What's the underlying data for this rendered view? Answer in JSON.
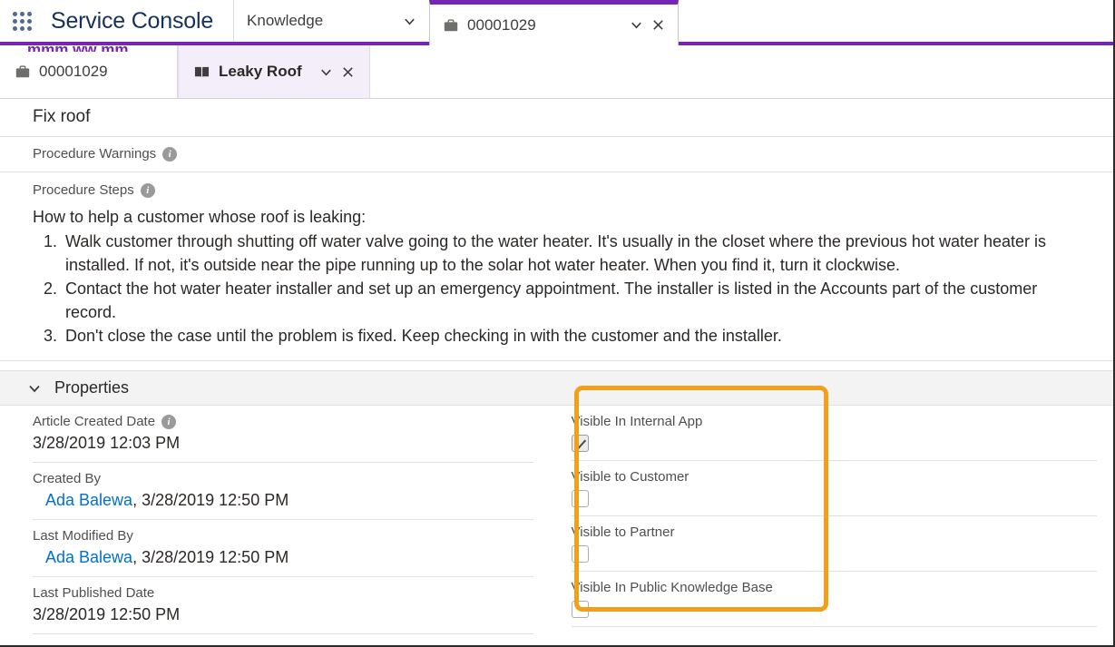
{
  "header": {
    "app_launcher_icon": "app-launcher-grid-icon",
    "app_name": "Service Console",
    "tabs": [
      {
        "label": "Knowledge",
        "icon": null,
        "active": false,
        "has_chevron": true,
        "has_close": false
      },
      {
        "label": "00001029",
        "icon": "case-briefcase-icon",
        "active": true,
        "has_chevron": true,
        "has_close": true
      }
    ],
    "accent_color": "#7526b5"
  },
  "subtabs": {
    "items": [
      {
        "label": "00001029",
        "icon": "case-briefcase-icon",
        "active": false,
        "has_chevron": false,
        "has_close": false
      },
      {
        "label": "Leaky Roof",
        "icon": "knowledge-book-icon",
        "active": true,
        "has_chevron": true,
        "has_close": true
      }
    ],
    "active_background": "#f4eefa"
  },
  "article": {
    "title": "Fix roof",
    "fields": [
      {
        "label": "Procedure Warnings",
        "has_info": true,
        "value": ""
      },
      {
        "label": "Procedure Steps",
        "has_info": true,
        "value": ""
      }
    ],
    "steps_intro": "How to help a customer whose roof is leaking:",
    "steps": [
      "Walk customer through shutting off water valve going to the water heater. It's usually in the closet where the previous hot water heater is installed. If not, it's outside near the pipe running up to the solar hot water heater. When you find it, turn it clockwise.",
      "Contact the hot water heater installer and set up an emergency appointment. The installer is listed in the Accounts part of the customer record.",
      "Don't close the case until the problem is fixed. Keep checking in with the customer and the installer."
    ]
  },
  "properties": {
    "section_title": "Properties",
    "collapse_icon": "chevron-down-icon",
    "left_fields": [
      {
        "label": "Article Created Date",
        "has_info": true,
        "value": "3/28/2019 12:03 PM",
        "link": null,
        "indent": false
      },
      {
        "label": "Created By",
        "has_info": false,
        "link": "Ada Balewa",
        "value": ", 3/28/2019 12:50 PM",
        "indent": true
      },
      {
        "label": "Last Modified By",
        "has_info": false,
        "link": "Ada Balewa",
        "value": ", 3/28/2019 12:50 PM",
        "indent": true
      },
      {
        "label": "Last Published Date",
        "has_info": false,
        "value": "3/28/2019 12:50 PM",
        "link": null,
        "indent": false
      }
    ],
    "right_fields": [
      {
        "label": "Visible In Internal App",
        "checked": true
      },
      {
        "label": "Visible to Customer",
        "checked": false
      },
      {
        "label": "Visible to Partner",
        "checked": false
      },
      {
        "label": "Visible In Public Knowledge Base",
        "checked": false
      }
    ]
  },
  "annotation": {
    "highlight_color": "#f2a01c",
    "target": "visibility-checkbox-group"
  }
}
